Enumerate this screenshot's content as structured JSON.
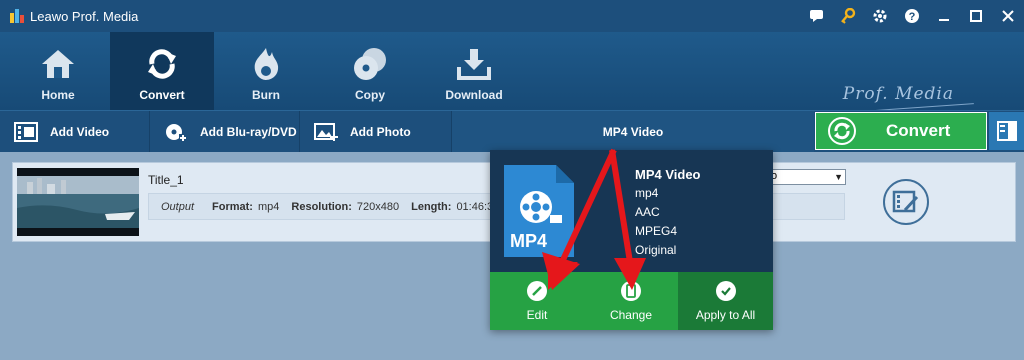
{
  "app": {
    "title": "Leawo Prof. Media",
    "brand": "Prof. Media"
  },
  "window_controls": [
    "chat-icon",
    "key-icon",
    "gear-icon",
    "help-icon",
    "minimize-icon",
    "maximize-icon",
    "close-icon"
  ],
  "nav": {
    "items": [
      {
        "label": "Home",
        "icon": "home-icon"
      },
      {
        "label": "Convert",
        "icon": "convert-icon",
        "active": true
      },
      {
        "label": "Burn",
        "icon": "burn-icon"
      },
      {
        "label": "Copy",
        "icon": "copy-icon"
      },
      {
        "label": "Download",
        "icon": "download-icon"
      }
    ]
  },
  "toolbar": {
    "add_video": "Add Video",
    "add_bluray": "Add Blu-ray/DVD",
    "add_photo": "Add Photo",
    "format": "MP4 Video",
    "convert": "Convert"
  },
  "file": {
    "title": "Title_1",
    "output_label": "Output",
    "format_label": "Format:",
    "format_value": "mp4",
    "resolution_label": "Resolution:",
    "resolution_value": "720x480",
    "length_label": "Length:",
    "length_value": "01:46:3",
    "dropdown_value": "o"
  },
  "popup": {
    "file_label": "MP4",
    "title": "MP4 Video",
    "lines": [
      "mp4",
      "AAC",
      "MPEG4",
      "Original"
    ],
    "actions": {
      "edit": "Edit",
      "change": "Change",
      "apply": "Apply to All"
    }
  },
  "colors": {
    "titlebar": "#1d4f7c",
    "convert_green": "#2cae4f",
    "popup_bg": "#173654",
    "arrow_red": "#e5171b"
  }
}
